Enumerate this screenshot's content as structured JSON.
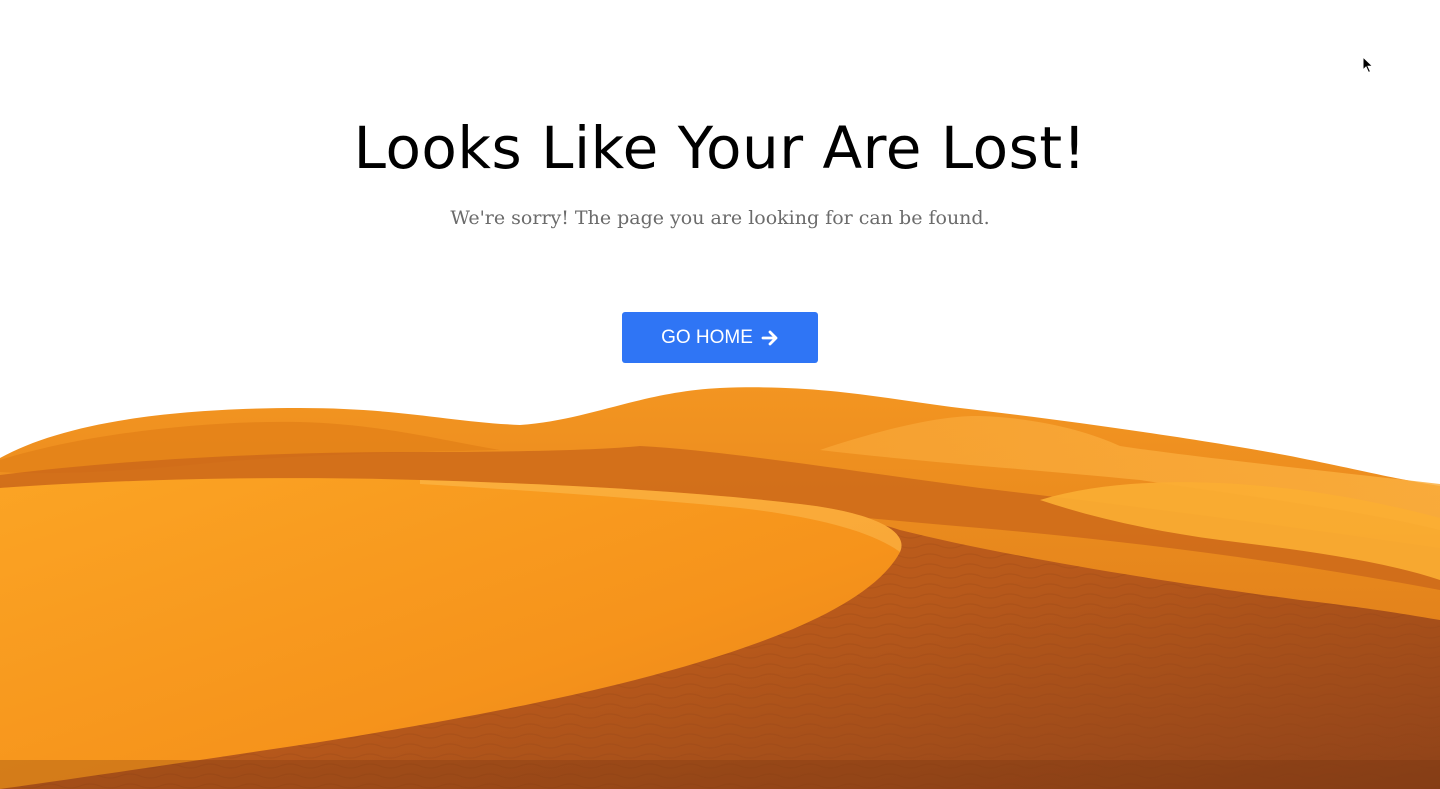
{
  "main": {
    "headline": "Looks Like Your Are Lost!",
    "subtitle": "We're sorry! The page you are looking for can be found.",
    "button": {
      "label": "GO HOME",
      "icon": "arrow-right-icon",
      "color": "#2f75f5"
    }
  },
  "illustration": {
    "subject": "desert-dunes",
    "colors": {
      "sand_light": "#f99a1d",
      "sand_mid": "#e98515",
      "sand_dark": "#b2541c"
    }
  }
}
